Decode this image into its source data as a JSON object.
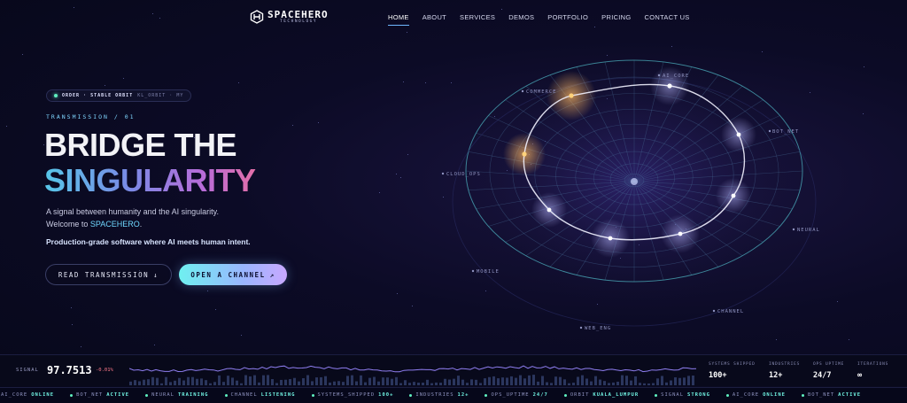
{
  "brand": {
    "name": "SPACEHERO",
    "tagline": "TECHNOLOGY",
    "accent": "#6fd8ff",
    "gradient": [
      "#57c6e8",
      "#7a8ae6",
      "#b86cd8",
      "#e36fa8"
    ]
  },
  "nav": {
    "items": [
      {
        "label": "HOME",
        "active": true
      },
      {
        "label": "ABOUT"
      },
      {
        "label": "SERVICES"
      },
      {
        "label": "DEMOS"
      },
      {
        "label": "PORTFOLIO"
      },
      {
        "label": "PRICING"
      },
      {
        "label": "CONTACT US"
      }
    ]
  },
  "hero": {
    "status": {
      "state": "ORDER · STABLE ORBIT",
      "code": "KL_ORBIT · MY"
    },
    "eyebrow": "TRANSMISSION / 01",
    "title_line1": "BRIDGE THE",
    "title_line2": "SINGULARITY",
    "subtitle_line1": "A signal between humanity and the AI singularity.",
    "subtitle_line2_prefix": "Welcome to ",
    "subtitle_line2_brand": "SPACEHERO",
    "subtitle_line2_suffix": ".",
    "tagline": "Production-grade software where AI meets human intent.",
    "buttons": {
      "read": {
        "label": "READ TRANSMISSION",
        "icon": "↓"
      },
      "open": {
        "label": "OPEN A CHANNEL",
        "icon": "↗"
      }
    }
  },
  "globe": {
    "nodes": [
      "AI_CORE",
      "BOT_NET",
      "NEURAL",
      "CHANNEL",
      "WEB_ENG",
      "MOBILE",
      "CLOUD_OPS",
      "COMMERCE"
    ]
  },
  "signal": {
    "label": "SIGNAL",
    "value": "97.7513",
    "delta": "-0.01%",
    "stats": [
      {
        "label": "SYSTEMS SHIPPED",
        "value": "100+"
      },
      {
        "label": "INDUSTRIES",
        "value": "12+"
      },
      {
        "label": "OPS UPTIME",
        "value": "24/7"
      },
      {
        "label": "ITERATIONS",
        "value": "∞"
      }
    ]
  },
  "ticker": [
    {
      "key": "AI_CORE",
      "val": "ONLINE"
    },
    {
      "key": "BOT_NET",
      "val": "ACTIVE"
    },
    {
      "key": "NEURAL",
      "val": "TRAINING"
    },
    {
      "key": "CHANNEL",
      "val": "LISTENING"
    },
    {
      "key": "SYSTEMS_SHIPPED",
      "val": "100+"
    },
    {
      "key": "INDUSTRIES",
      "val": "12+"
    },
    {
      "key": "OPS_UPTIME",
      "val": "24/7"
    },
    {
      "key": "ORBIT",
      "val": "KUALA_LUMPUR"
    },
    {
      "key": "SIGNAL",
      "val": "STRONG"
    },
    {
      "key": "AI_CORE",
      "val": "ONLINE"
    },
    {
      "key": "BOT_NET",
      "val": "ACTIVE"
    }
  ]
}
